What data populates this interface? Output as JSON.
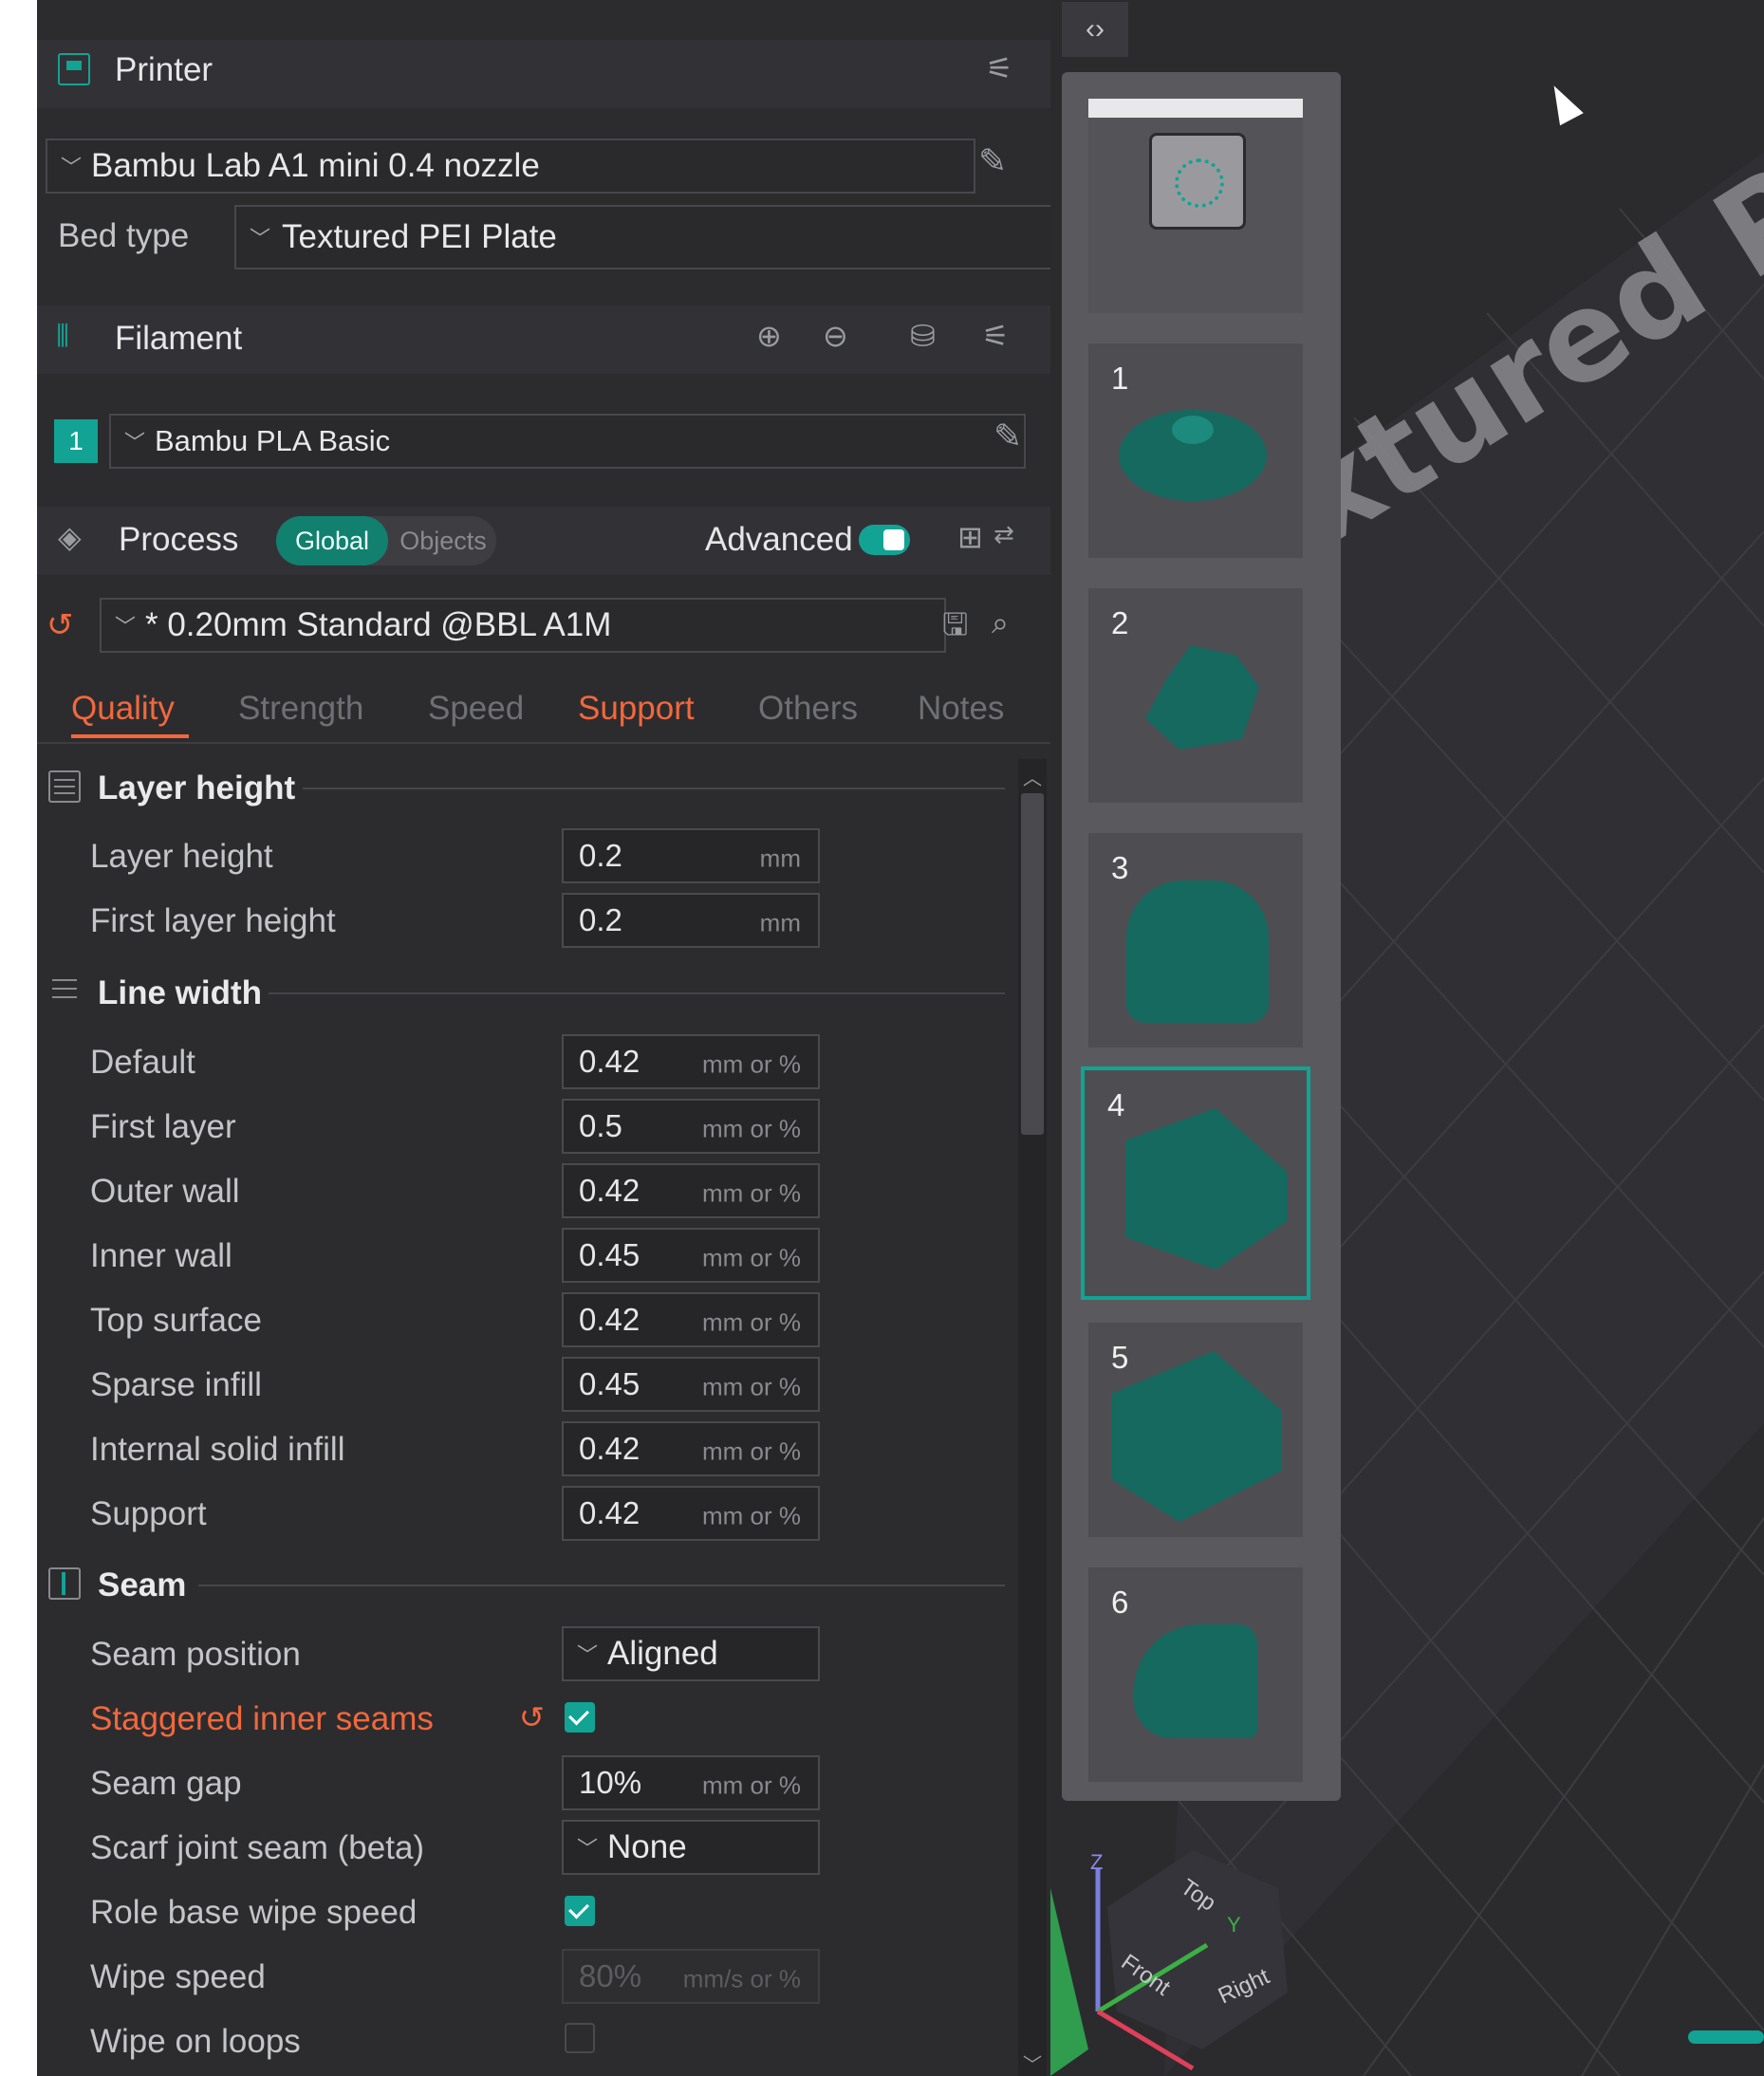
{
  "printer": {
    "section_title": "Printer",
    "model": "Bambu Lab A1 mini 0.4 nozzle",
    "bed_type_label": "Bed type",
    "bed_type": "Textured PEI Plate"
  },
  "filament": {
    "section_title": "Filament",
    "slot_number": "1",
    "slot_color": "#12a394",
    "name": "Bambu PLA Basic"
  },
  "process": {
    "section_title": "Process",
    "toggle_global": "Global",
    "toggle_objects": "Objects",
    "advanced_label": "Advanced",
    "advanced_on": true,
    "preset": "* 0.20mm Standard @BBL A1M"
  },
  "tabs": [
    {
      "label": "Quality",
      "active": true,
      "modified": true
    },
    {
      "label": "Strength",
      "active": false,
      "modified": false
    },
    {
      "label": "Speed",
      "active": false,
      "modified": false
    },
    {
      "label": "Support",
      "active": false,
      "modified": true
    },
    {
      "label": "Others",
      "active": false,
      "modified": false
    },
    {
      "label": "Notes",
      "active": false,
      "modified": false
    }
  ],
  "layer_height_group": {
    "title": "Layer height",
    "rows": [
      {
        "label": "Layer height",
        "value": "0.2",
        "unit": "mm"
      },
      {
        "label": "First layer height",
        "value": "0.2",
        "unit": "mm"
      }
    ]
  },
  "line_width_group": {
    "title": "Line width",
    "rows": [
      {
        "label": "Default",
        "value": "0.42",
        "unit": "mm or %"
      },
      {
        "label": "First layer",
        "value": "0.5",
        "unit": "mm or %"
      },
      {
        "label": "Outer wall",
        "value": "0.42",
        "unit": "mm or %"
      },
      {
        "label": "Inner wall",
        "value": "0.45",
        "unit": "mm or %"
      },
      {
        "label": "Top surface",
        "value": "0.42",
        "unit": "mm or %"
      },
      {
        "label": "Sparse infill",
        "value": "0.45",
        "unit": "mm or %"
      },
      {
        "label": "Internal solid infill",
        "value": "0.42",
        "unit": "mm or %"
      },
      {
        "label": "Support",
        "value": "0.42",
        "unit": "mm or %"
      }
    ]
  },
  "seam_group": {
    "title": "Seam",
    "seam_position_label": "Seam position",
    "seam_position_value": "Aligned",
    "staggered_label": "Staggered inner seams",
    "staggered_checked": true,
    "seam_gap_label": "Seam gap",
    "seam_gap_value": "10%",
    "seam_gap_unit": "mm or %",
    "scarf_label": "Scarf joint seam (beta)",
    "scarf_value": "None",
    "role_wipe_label": "Role base wipe speed",
    "role_wipe_checked": true,
    "wipe_speed_label": "Wipe speed",
    "wipe_speed_value": "80%",
    "wipe_speed_unit": "mm/s or %",
    "wipe_loops_label": "Wipe on loops",
    "wipe_loops_checked": false
  },
  "plates": [
    {
      "number": "1"
    },
    {
      "number": "2"
    },
    {
      "number": "3"
    },
    {
      "number": "4",
      "selected": true
    },
    {
      "number": "5"
    },
    {
      "number": "6"
    }
  ],
  "bed_print": "Textured PEI Plate",
  "axes": {
    "z": "Z",
    "y": "Y",
    "top": "Top",
    "front": "Front",
    "right": "Right"
  },
  "colors": {
    "accent": "#12a394",
    "modified": "#f2683c",
    "panel_bg": "#2c2c2f",
    "viewport_bg": "#2b2b2e"
  }
}
